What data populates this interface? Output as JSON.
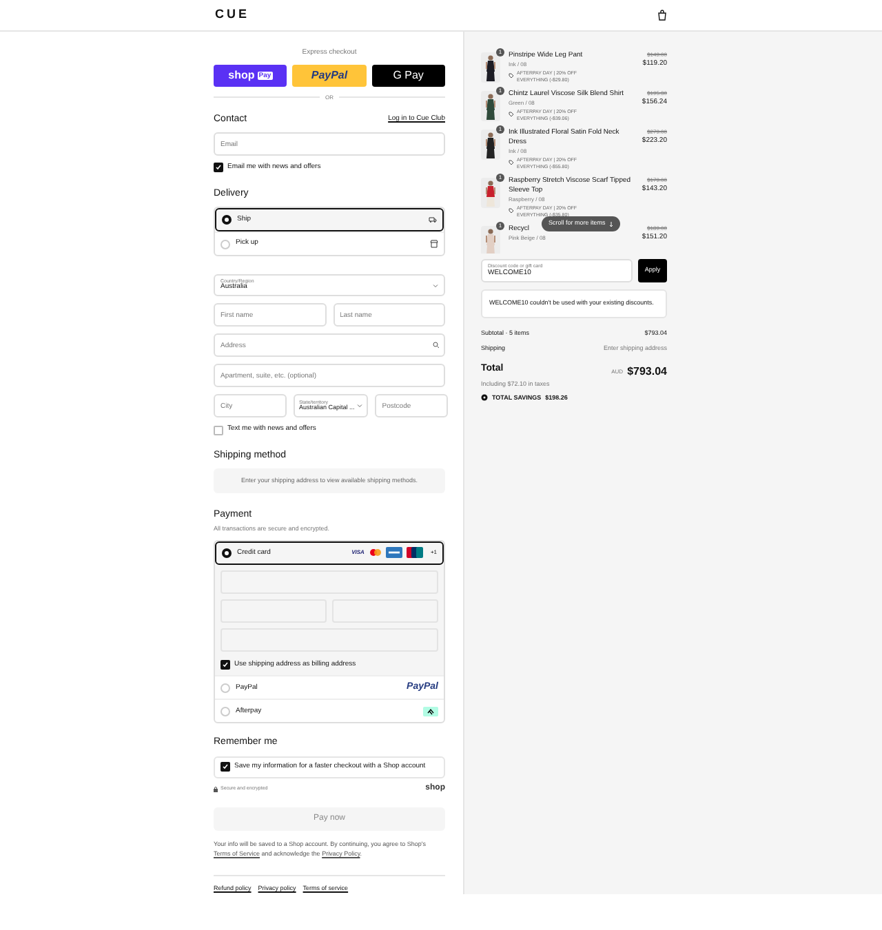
{
  "header": {
    "logo": "CUE"
  },
  "express_checkout": {
    "title": "Express checkout",
    "buttons": [
      {
        "kind": "shop",
        "label": "shop",
        "badge": "Pay"
      },
      {
        "kind": "paypal",
        "label": "PayPal"
      },
      {
        "kind": "gpay",
        "label": "G Pay"
      }
    ],
    "divider": "OR"
  },
  "contact": {
    "title": "Contact",
    "login_link": "Log in to Cue Club",
    "email": {
      "placeholder": "Email"
    },
    "newsletter": {
      "label": "Email me with news and offers",
      "checked": true
    }
  },
  "delivery": {
    "title": "Delivery",
    "options": [
      {
        "kind": "ship",
        "label": "Ship",
        "selected": true
      },
      {
        "kind": "pickup",
        "label": "Pick up",
        "selected": false
      }
    ],
    "country": {
      "label": "Country/Region",
      "value": "Australia"
    },
    "first_name": {
      "placeholder": "First name"
    },
    "last_name": {
      "placeholder": "Last name"
    },
    "address": {
      "placeholder": "Address"
    },
    "apartment": {
      "placeholder": "Apartment, suite, etc. (optional)"
    },
    "city": {
      "placeholder": "City"
    },
    "state": {
      "label": "State/territory",
      "value": "Australian Capital ..."
    },
    "postcode": {
      "placeholder": "Postcode"
    },
    "sms": {
      "label": "Text me with news and offers",
      "checked": false
    }
  },
  "shipping_method": {
    "title": "Shipping method",
    "message": "Enter your shipping address to view available shipping methods."
  },
  "payment": {
    "title": "Payment",
    "subtitle": "All transactions are secure and encrypted.",
    "methods": [
      {
        "kind": "card",
        "label": "Credit card",
        "selected": true
      },
      {
        "kind": "paypal",
        "label": "PayPal",
        "logo": "PayPal",
        "selected": false
      },
      {
        "kind": "afterpay",
        "label": "Afterpay",
        "selected": false
      }
    ],
    "card_brands": [
      {
        "kind": "visa",
        "label": "VISA"
      },
      {
        "kind": "mastercard"
      },
      {
        "kind": "amex"
      },
      {
        "kind": "unionpay"
      }
    ],
    "more_brands": "+1",
    "billing_same": {
      "label": "Use shipping address as billing address",
      "checked": true
    }
  },
  "remember_me": {
    "title": "Remember me",
    "save": {
      "label": "Save my information for a faster checkout with a Shop account",
      "checked": true
    },
    "secure_note": "Secure and encrypted",
    "shop_logo": "shop"
  },
  "pay_button": "Pay now",
  "disclaimer": [
    {
      "text": "Your info will be saved to a Shop account. By continuing, you agree to Shop's "
    },
    {
      "text": "Terms of Service",
      "link": true
    },
    {
      "text": " and acknowledge the "
    },
    {
      "text": "Privacy Policy",
      "link": true
    },
    {
      "text": "."
    }
  ],
  "footer_links": [
    "Refund policy",
    "Privacy policy",
    "Terms of service"
  ],
  "order_summary": {
    "items": [
      {
        "name": "Pinstripe Wide Leg Pant",
        "quantity": "1",
        "variant": "Ink / 08",
        "discount": "AFTERPAY DAY | 20% OFF EVERYTHING (-$29.80)",
        "compare_price": "$149.00",
        "price": "$119.20"
      },
      {
        "name": "Chintz Laurel Viscose Silk Blend Shirt",
        "quantity": "1",
        "variant": "Green / 08",
        "discount": "AFTERPAY DAY | 20% OFF EVERYTHING (-$39.06)",
        "compare_price": "$195.30",
        "price": "$156.24"
      },
      {
        "name": "Ink Illustrated Floral Satin Fold Neck Dress",
        "quantity": "1",
        "variant": "Ink / 08",
        "discount": "AFTERPAY DAY | 20% OFF EVERYTHING (-$55.80)",
        "compare_price": "$279.00",
        "price": "$223.20"
      },
      {
        "name": "Raspberry Stretch Viscose Scarf Tipped Sleeve Top",
        "quantity": "1",
        "variant": "Raspberry / 08",
        "discount": "AFTERPAY DAY | 20% OFF EVERYTHING (-$35.80)",
        "compare_price": "$179.00",
        "price": "$143.20"
      },
      {
        "name": "Recycl",
        "quantity": "1",
        "variant": "Pink Beige / 08",
        "compare_price": "$189.00",
        "price": "$151.20"
      }
    ],
    "scroll_hint": "Scroll for more items",
    "discount_field": {
      "label": "Discount code or gift card",
      "value": "WELCOME10"
    },
    "apply_button": "Apply",
    "error": "WELCOME10 couldn't be used with your existing discounts.",
    "subtotal": {
      "label": "Subtotal · 5 items",
      "value": "$793.04"
    },
    "shipping": {
      "label": "Shipping",
      "value": "Enter shipping address"
    },
    "total": {
      "label": "Total",
      "currency": "AUD",
      "value": "$793.04"
    },
    "taxes": "Including $72.10 in taxes",
    "savings": {
      "label": "TOTAL SAVINGS",
      "value": "$198.26"
    }
  }
}
